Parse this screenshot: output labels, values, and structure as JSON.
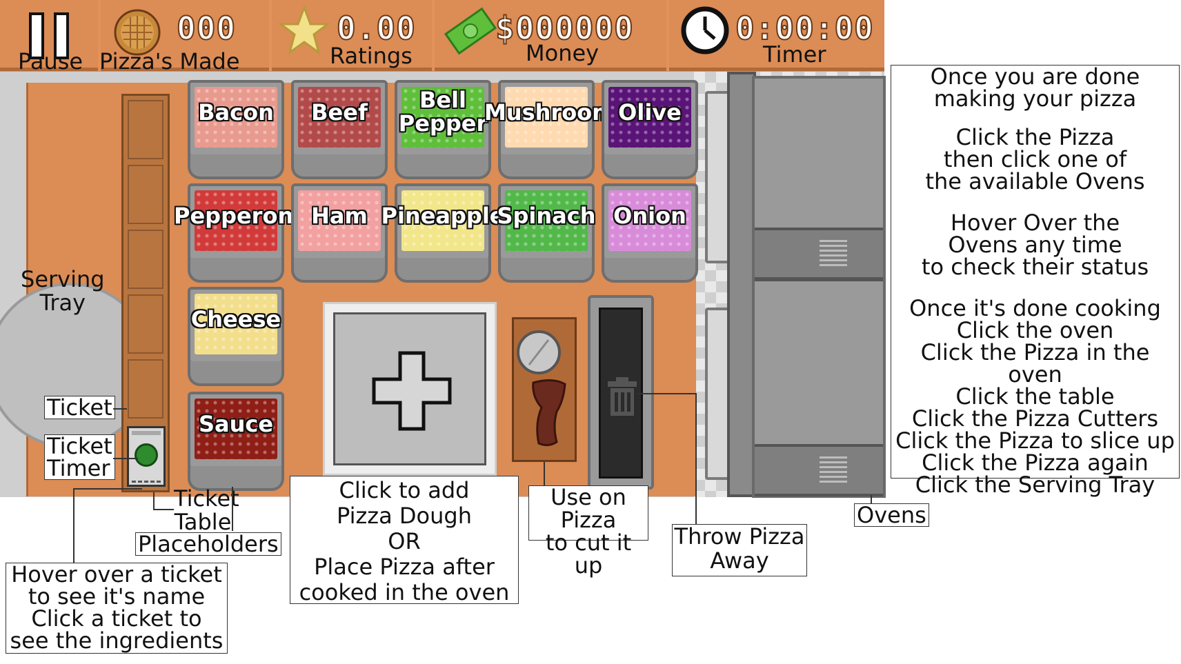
{
  "hud": {
    "pause_label": "Pause",
    "pizzas_made_label": "Pizza's Made",
    "pizzas_made_value": "000",
    "ratings_label": "Ratings",
    "ratings_value": "0.00",
    "money_label": "Money",
    "money_value": "$000000",
    "timer_label": "Timer",
    "timer_value": "0:00:00"
  },
  "serving_tray": {
    "label": "Serving\nTray"
  },
  "toppings": [
    {
      "label": "Bacon",
      "color": "#e89a8e"
    },
    {
      "label": "Beef",
      "color": "#b34a4a"
    },
    {
      "label": "Bell\nPepper",
      "color": "#5fbf3a"
    },
    {
      "label": "Mushroom",
      "color": "#ffd9b0"
    },
    {
      "label": "Olive",
      "color": "#5a1478"
    },
    {
      "label": "Pepperoni",
      "color": "#d23a3a"
    },
    {
      "label": "Ham",
      "color": "#f2a0a0"
    },
    {
      "label": "Pineapple",
      "color": "#f2e68a"
    },
    {
      "label": "Spinach",
      "color": "#52b84a"
    },
    {
      "label": "Onion",
      "color": "#d88bd8"
    },
    {
      "label": "Cheese",
      "color": "#f3de8c"
    },
    {
      "label": "Sauce",
      "color": "#8f1e16"
    }
  ],
  "callouts": {
    "ticket": "Ticket",
    "ticket_timer": "Ticket\nTimer",
    "ticket_table_placeholders_1": "Ticket\nTable",
    "ticket_table_placeholders_2": "Placeholders",
    "hover_ticket": "Hover over a ticket\nto see it's name\nClick a ticket to\nsee the ingredients",
    "dough": "Click to add\nPizza Dough\nOR\nPlace Pizza after\ncooked in the oven",
    "cutter": "Use on Pizza\nto cut it up",
    "trash": "Throw Pizza\nAway",
    "ovens": "Ovens"
  },
  "instructions": {
    "p1": "Once you are done\nmaking your pizza",
    "p2": "Click the Pizza\nthen click one of\nthe available Ovens",
    "p3": "Hover Over the\nOvens any time\nto check their status",
    "p4": "Once it's done cooking\nClick the oven\nClick the Pizza in the oven\nClick the table\nClick the Pizza Cutters\nClick the Pizza to slice up\nClick the Pizza again\nClick the Serving Tray"
  },
  "colors": {
    "counter": "#dc8c55",
    "hud": "#e2925a",
    "money": "#5fbf3a",
    "ticket_timer": "#2e8b2e"
  }
}
